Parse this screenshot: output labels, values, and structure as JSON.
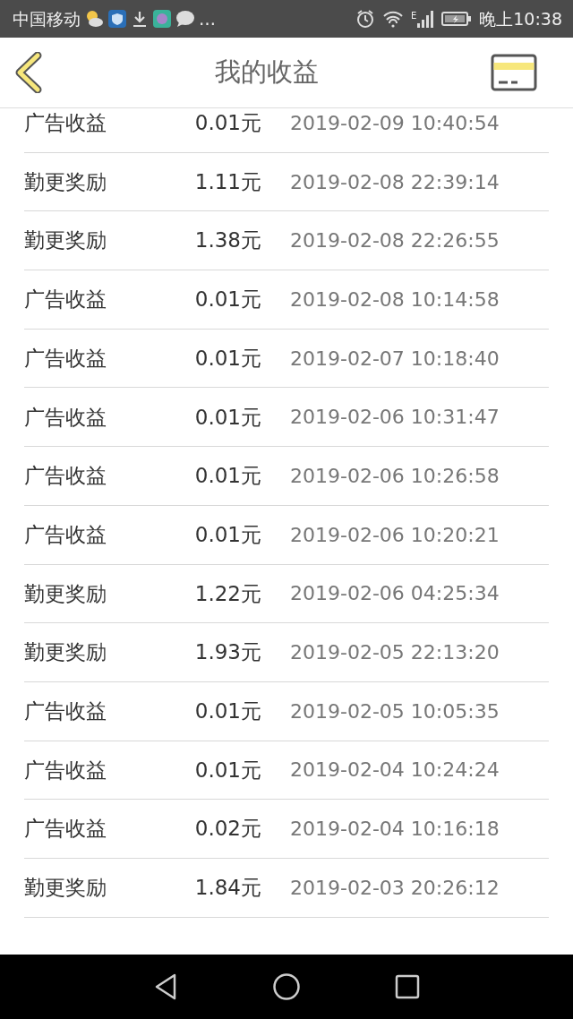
{
  "status_bar": {
    "carrier": "中国移动",
    "more": "…",
    "network": "E",
    "time": "晚上10:38"
  },
  "header": {
    "title": "我的收益"
  },
  "records": [
    {
      "type": "广告收益",
      "amount": "0.01元",
      "time": "2019-02-09 10:40:54"
    },
    {
      "type": "勤更奖励",
      "amount": "1.11元",
      "time": "2019-02-08 22:39:14"
    },
    {
      "type": "勤更奖励",
      "amount": "1.38元",
      "time": "2019-02-08 22:26:55"
    },
    {
      "type": "广告收益",
      "amount": "0.01元",
      "time": "2019-02-08 10:14:58"
    },
    {
      "type": "广告收益",
      "amount": "0.01元",
      "time": "2019-02-07 10:18:40"
    },
    {
      "type": "广告收益",
      "amount": "0.01元",
      "time": "2019-02-06 10:31:47"
    },
    {
      "type": "广告收益",
      "amount": "0.01元",
      "time": "2019-02-06 10:26:58"
    },
    {
      "type": "广告收益",
      "amount": "0.01元",
      "time": "2019-02-06 10:20:21"
    },
    {
      "type": "勤更奖励",
      "amount": "1.22元",
      "time": "2019-02-06 04:25:34"
    },
    {
      "type": "勤更奖励",
      "amount": "1.93元",
      "time": "2019-02-05 22:13:20"
    },
    {
      "type": "广告收益",
      "amount": "0.01元",
      "time": "2019-02-05 10:05:35"
    },
    {
      "type": "广告收益",
      "amount": "0.01元",
      "time": "2019-02-04 10:24:24"
    },
    {
      "type": "广告收益",
      "amount": "0.02元",
      "time": "2019-02-04 10:16:18"
    },
    {
      "type": "勤更奖励",
      "amount": "1.84元",
      "time": "2019-02-03 20:26:12"
    }
  ]
}
